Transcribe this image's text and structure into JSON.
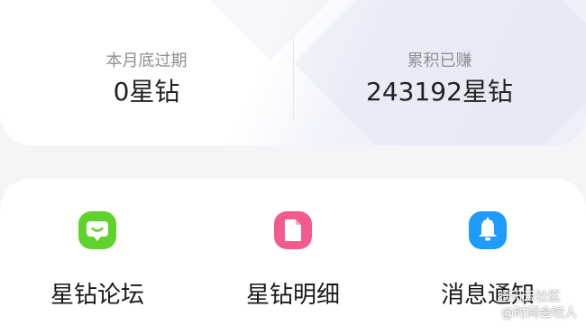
{
  "stats": {
    "expiring": {
      "label": "本月底过期",
      "value": "0星钻"
    },
    "earned": {
      "label": "累积已赚",
      "value": "243192星钻"
    }
  },
  "features": [
    {
      "label": "星钻论坛",
      "icon": "chat-bubble-icon",
      "color": "#5fd22c"
    },
    {
      "label": "星钻明细",
      "icon": "document-icon",
      "color": "#f35b8e"
    },
    {
      "label": "消息通知",
      "icon": "bell-icon",
      "color": "#1f9bfb"
    }
  ],
  "watermark": {
    "line1": "腾讯云社区",
    "line2": "@时间会咬人"
  }
}
